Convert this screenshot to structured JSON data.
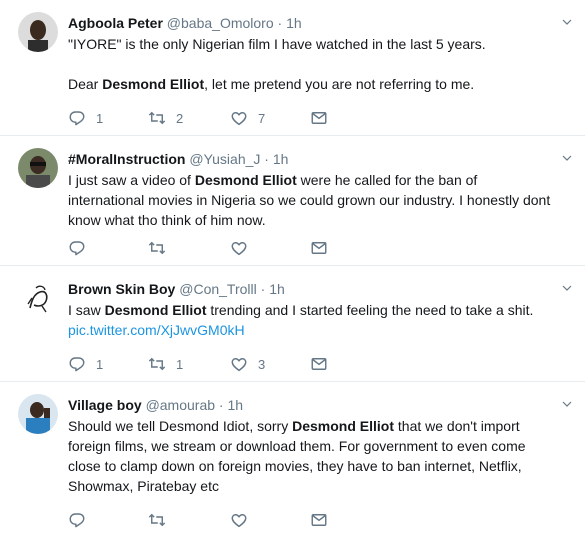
{
  "tweets": [
    {
      "name": "Agboola Peter",
      "handle": "@baba_Omoloro",
      "dot": "·",
      "time": "1h",
      "text1": "\"IYORE\" is the only Nigerian film I have watched in the last 5 years.",
      "text2a": "Dear ",
      "text2b": "Desmond Elliot",
      "text2c": ", let me pretend you are not referring to me.",
      "replies": "1",
      "retweets": "2",
      "likes": "7"
    },
    {
      "name": "#MoralInstruction",
      "handle": "@Yusiah_J",
      "dot": "·",
      "time": "1h",
      "text_a": "I just saw a video of ",
      "text_b": "Desmond Elliot",
      "text_c": " were he called for the ban of international movies in Nigeria so we could grown our industry.  I honestly dont know what tho think of him now.",
      "replies": "",
      "retweets": "",
      "likes": ""
    },
    {
      "name": "Brown Skin Boy",
      "handle": "@Con_Trolll",
      "dot": "·",
      "time": "1h",
      "text_a": "I saw ",
      "text_b": "Desmond Elliot",
      "text_c": " trending and I started feeling the need to take a shit.",
      "link": "pic.twitter.com/XjJwvGM0kH",
      "replies": "1",
      "retweets": "1",
      "likes": "3"
    },
    {
      "name": "Village boy",
      "handle": "@amourab",
      "dot": "·",
      "time": "1h",
      "text_a": "Should we tell Desmond Idiot, sorry ",
      "text_b": "Desmond Elliot",
      "text_c": " that we don't import foreign films, we stream or download them. For government to even come close to clamp down on foreign movies, they have to ban internet, Netflix, Showmax, Piratebay etc",
      "replies": "",
      "retweets": "",
      "likes": ""
    }
  ],
  "icons": {
    "reply": "reply-icon",
    "retweet": "retweet-icon",
    "like": "heart-icon",
    "dm": "envelope-icon",
    "caret": "chevron-down-icon"
  },
  "colors": {
    "text": "#14171a",
    "secondary": "#657786",
    "link": "#1b95e0",
    "divider": "#e6ecf0"
  }
}
